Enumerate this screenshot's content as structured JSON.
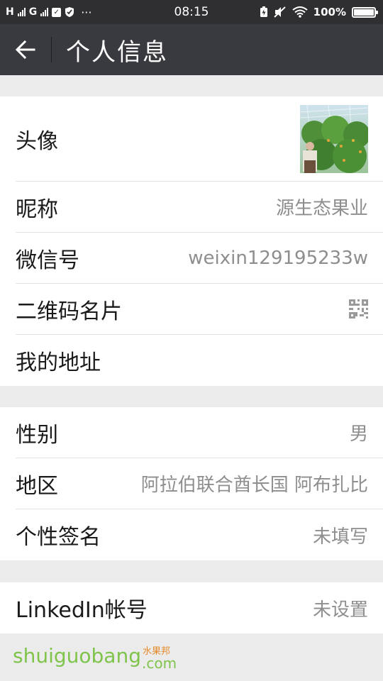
{
  "status_bar": {
    "signal_1": "H",
    "signal_2": "G",
    "time": "08:15",
    "battery": "100%"
  },
  "header": {
    "title": "个人信息"
  },
  "profile": {
    "avatar_label": "头像",
    "nickname_label": "昵称",
    "nickname_value": "源生态果业",
    "wechat_id_label": "微信号",
    "wechat_id_value": "weixin129195233w",
    "qr_card_label": "二维码名片",
    "address_label": "我的地址"
  },
  "details": {
    "gender_label": "性别",
    "gender_value": "男",
    "region_label": "地区",
    "region_value": "阿拉伯联合酋长国 阿布扎比",
    "signature_label": "个性签名",
    "signature_value": "未填写"
  },
  "linkedin": {
    "label": "LinkedIn帐号",
    "value": "未设置"
  },
  "watermark": {
    "text": "shuiguobang",
    "cn": "水果邦",
    "suffix": ".com"
  },
  "colors": {
    "status_bar_bg": "#2f2f32",
    "title_bar_bg": "#393a3f",
    "page_bg": "#ebebeb",
    "watermark_green": "#7fc44a"
  }
}
